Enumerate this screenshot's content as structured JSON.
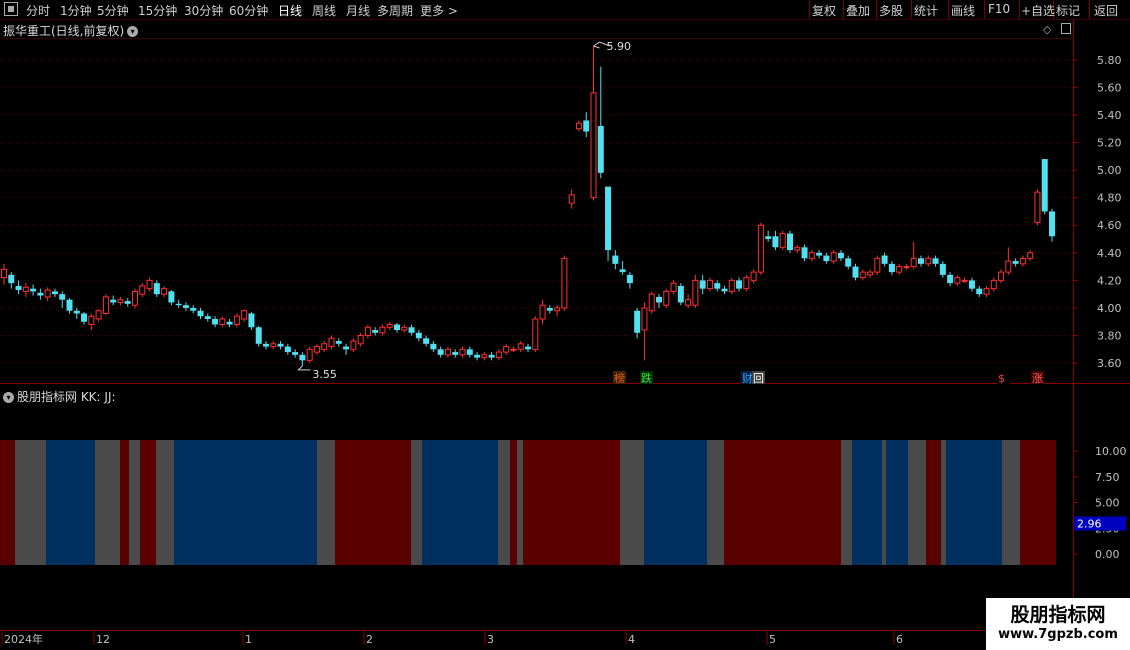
{
  "toolbar": {
    "periods": [
      "分时",
      "1分钟",
      "5分钟",
      "15分钟",
      "30分钟",
      "60分钟",
      "日线",
      "周线",
      "月线",
      "多周期",
      "更多 >"
    ],
    "active_period": "日线",
    "right_buttons": [
      "复权",
      "叠加",
      "多股",
      "统计",
      "画线",
      "F10",
      "+自选",
      "返回"
    ]
  },
  "main_panel": {
    "title": "振华重工(日线,前复权)",
    "high_label": "5.90",
    "low_label": "3.55",
    "price_ticks": [
      "5.80",
      "5.60",
      "5.40",
      "5.20",
      "5.00",
      "4.80",
      "4.60",
      "4.40",
      "4.20",
      "4.00",
      "3.80",
      "3.60"
    ],
    "tags": [
      {
        "text": "榜",
        "color": "#e06020",
        "bg": "#402000"
      },
      {
        "text": "跌",
        "color": "#40e040",
        "bg": "#003000"
      },
      {
        "text": "财",
        "color": "#40a0ff",
        "bg": "#002040"
      },
      {
        "text": "回",
        "color": "#ffffff",
        "bg": "#404040"
      },
      {
        "text": "$",
        "color": "#ff4040",
        "bg": "#000000"
      },
      {
        "text": "涨",
        "color": "#ff6060",
        "bg": "#400000"
      }
    ]
  },
  "indicator_panel": {
    "title": "股朋指标网 KK: JJ:",
    "ticks": [
      "10.00",
      "7.50",
      "5.00",
      "2.50",
      "0.00"
    ],
    "current_value": "2.96",
    "colors": {
      "red": "#5a0000",
      "gray": "#4a4a4a",
      "blue": "#003060"
    },
    "segments": [
      {
        "c": "red",
        "from": 0,
        "to": 15
      },
      {
        "c": "gray",
        "from": 15,
        "to": 46
      },
      {
        "c": "blue",
        "from": 46,
        "to": 95
      },
      {
        "c": "gray",
        "from": 95,
        "to": 120
      },
      {
        "c": "red",
        "from": 120,
        "to": 129
      },
      {
        "c": "gray",
        "from": 129,
        "to": 140
      },
      {
        "c": "red",
        "from": 140,
        "to": 156
      },
      {
        "c": "gray",
        "from": 156,
        "to": 174
      },
      {
        "c": "blue",
        "from": 174,
        "to": 317
      },
      {
        "c": "gray",
        "from": 317,
        "to": 335
      },
      {
        "c": "red",
        "from": 335,
        "to": 411
      },
      {
        "c": "gray",
        "from": 411,
        "to": 422
      },
      {
        "c": "blue",
        "from": 422,
        "to": 498
      },
      {
        "c": "gray",
        "from": 498,
        "to": 510
      },
      {
        "c": "red",
        "from": 510,
        "to": 517
      },
      {
        "c": "gray",
        "from": 517,
        "to": 523
      },
      {
        "c": "red",
        "from": 523,
        "to": 620
      },
      {
        "c": "gray",
        "from": 620,
        "to": 644
      },
      {
        "c": "blue",
        "from": 644,
        "to": 707
      },
      {
        "c": "gray",
        "from": 707,
        "to": 724
      },
      {
        "c": "red",
        "from": 724,
        "to": 841
      },
      {
        "c": "gray",
        "from": 841,
        "to": 852
      },
      {
        "c": "blue",
        "from": 852,
        "to": 882
      },
      {
        "c": "gray",
        "from": 882,
        "to": 886
      },
      {
        "c": "blue",
        "from": 886,
        "to": 908
      },
      {
        "c": "gray",
        "from": 908,
        "to": 926
      },
      {
        "c": "red",
        "from": 926,
        "to": 941
      },
      {
        "c": "gray",
        "from": 941,
        "to": 946
      },
      {
        "c": "blue",
        "from": 946,
        "to": 1002
      },
      {
        "c": "gray",
        "from": 1002,
        "to": 1020
      },
      {
        "c": "red",
        "from": 1020,
        "to": 1056
      }
    ]
  },
  "date_axis": {
    "labels": [
      "2024年",
      "12",
      "1",
      "2",
      "3",
      "4",
      "5",
      "6"
    ]
  },
  "watermark": {
    "line1": "股朋指标网",
    "line2": "www.7gpzb.com"
  },
  "chart_data": {
    "type": "candlestick",
    "title": "振华重工(日线,前复权)",
    "ylim": [
      3.5,
      5.95
    ],
    "colors": {
      "up": "#ff3030",
      "down": "#50e0f0"
    },
    "candles": [
      [
        4.22,
        4.28,
        4.32,
        4.17
      ],
      [
        4.24,
        4.18,
        4.26,
        4.14
      ],
      [
        4.16,
        4.13,
        4.2,
        4.1
      ],
      [
        4.12,
        4.15,
        4.18,
        4.08
      ],
      [
        4.14,
        4.12,
        4.17,
        4.09
      ],
      [
        4.11,
        4.09,
        4.14,
        4.06
      ],
      [
        4.08,
        4.13,
        4.15,
        4.05
      ],
      [
        4.12,
        4.1,
        4.14,
        4.08
      ],
      [
        4.1,
        4.06,
        4.12,
        4.0
      ],
      [
        4.06,
        3.98,
        4.07,
        3.96
      ],
      [
        3.98,
        3.96,
        4.0,
        3.92
      ],
      [
        3.96,
        3.9,
        3.97,
        3.88
      ],
      [
        3.88,
        3.94,
        3.96,
        3.84
      ],
      [
        3.92,
        3.98,
        3.99,
        3.9
      ],
      [
        3.96,
        4.08,
        4.1,
        3.95
      ],
      [
        4.06,
        4.04,
        4.09,
        4.02
      ],
      [
        4.04,
        4.06,
        4.08,
        4.02
      ],
      [
        4.05,
        4.03,
        4.07,
        4.01
      ],
      [
        4.02,
        4.12,
        4.14,
        4.0
      ],
      [
        4.1,
        4.16,
        4.18,
        4.08
      ],
      [
        4.14,
        4.2,
        4.22,
        4.12
      ],
      [
        4.18,
        4.1,
        4.2,
        4.08
      ],
      [
        4.1,
        4.14,
        4.16,
        4.08
      ],
      [
        4.12,
        4.04,
        4.13,
        4.02
      ],
      [
        4.03,
        4.02,
        4.06,
        4.0
      ],
      [
        4.02,
        4.0,
        4.04,
        3.98
      ],
      [
        4.0,
        3.98,
        4.02,
        3.96
      ],
      [
        3.98,
        3.94,
        4.0,
        3.92
      ],
      [
        3.94,
        3.92,
        3.96,
        3.9
      ],
      [
        3.92,
        3.88,
        3.94,
        3.86
      ],
      [
        3.88,
        3.92,
        3.94,
        3.86
      ],
      [
        3.9,
        3.88,
        3.92,
        3.86
      ],
      [
        3.88,
        3.94,
        3.96,
        3.86
      ],
      [
        3.92,
        3.98,
        3.99,
        3.9
      ],
      [
        3.96,
        3.86,
        3.97,
        3.84
      ],
      [
        3.86,
        3.74,
        3.87,
        3.72
      ],
      [
        3.74,
        3.72,
        3.76,
        3.7
      ],
      [
        3.72,
        3.74,
        3.76,
        3.7
      ],
      [
        3.74,
        3.72,
        3.76,
        3.7
      ],
      [
        3.72,
        3.68,
        3.74,
        3.66
      ],
      [
        3.68,
        3.66,
        3.7,
        3.64
      ],
      [
        3.66,
        3.62,
        3.68,
        3.58
      ],
      [
        3.62,
        3.7,
        3.72,
        3.6
      ],
      [
        3.68,
        3.72,
        3.74,
        3.66
      ],
      [
        3.7,
        3.74,
        3.76,
        3.68
      ],
      [
        3.72,
        3.78,
        3.8,
        3.7
      ],
      [
        3.76,
        3.74,
        3.78,
        3.72
      ],
      [
        3.72,
        3.7,
        3.74,
        3.66
      ],
      [
        3.7,
        3.76,
        3.78,
        3.68
      ],
      [
        3.74,
        3.8,
        3.82,
        3.72
      ],
      [
        3.8,
        3.86,
        3.88,
        3.78
      ],
      [
        3.84,
        3.82,
        3.86,
        3.8
      ],
      [
        3.82,
        3.86,
        3.88,
        3.8
      ],
      [
        3.86,
        3.88,
        3.9,
        3.84
      ],
      [
        3.88,
        3.84,
        3.89,
        3.82
      ],
      [
        3.84,
        3.86,
        3.88,
        3.82
      ],
      [
        3.86,
        3.82,
        3.88,
        3.8
      ],
      [
        3.82,
        3.78,
        3.84,
        3.76
      ],
      [
        3.78,
        3.74,
        3.8,
        3.72
      ],
      [
        3.74,
        3.7,
        3.76,
        3.68
      ],
      [
        3.7,
        3.66,
        3.72,
        3.64
      ],
      [
        3.66,
        3.7,
        3.72,
        3.64
      ],
      [
        3.68,
        3.66,
        3.7,
        3.64
      ],
      [
        3.66,
        3.7,
        3.72,
        3.64
      ],
      [
        3.7,
        3.66,
        3.72,
        3.64
      ],
      [
        3.66,
        3.64,
        3.68,
        3.62
      ],
      [
        3.64,
        3.66,
        3.68,
        3.62
      ],
      [
        3.66,
        3.64,
        3.68,
        3.62
      ],
      [
        3.64,
        3.68,
        3.7,
        3.62
      ],
      [
        3.68,
        3.72,
        3.74,
        3.66
      ],
      [
        3.7,
        3.7,
        3.72,
        3.68
      ],
      [
        3.7,
        3.74,
        3.76,
        3.68
      ],
      [
        3.72,
        3.7,
        3.74,
        3.68
      ],
      [
        3.7,
        3.92,
        3.94,
        3.68
      ],
      [
        3.92,
        4.02,
        4.06,
        3.88
      ],
      [
        4.0,
        3.98,
        4.02,
        3.96
      ],
      [
        3.98,
        4.0,
        4.02,
        3.94
      ],
      [
        4.0,
        4.36,
        4.38,
        3.98
      ],
      [
        4.76,
        4.82,
        4.86,
        4.72
      ],
      [
        5.3,
        5.34,
        5.36,
        5.28
      ],
      [
        5.36,
        5.28,
        5.42,
        5.24
      ],
      [
        4.8,
        5.56,
        5.9,
        4.78
      ],
      [
        5.32,
        4.98,
        5.75,
        4.94
      ],
      [
        4.88,
        4.42,
        4.88,
        4.34
      ],
      [
        4.38,
        4.32,
        4.42,
        4.28
      ],
      [
        4.28,
        4.26,
        4.34,
        4.24
      ],
      [
        4.24,
        4.18,
        4.26,
        4.14
      ],
      [
        3.98,
        3.82,
        4.0,
        3.78
      ],
      [
        3.84,
        4.0,
        4.04,
        3.62
      ],
      [
        3.98,
        4.1,
        4.12,
        3.96
      ],
      [
        4.08,
        4.04,
        4.1,
        4.0
      ],
      [
        4.02,
        4.12,
        4.14,
        4.0
      ],
      [
        4.12,
        4.18,
        4.2,
        4.1
      ],
      [
        4.16,
        4.04,
        4.18,
        4.02
      ],
      [
        4.02,
        4.06,
        4.1,
        4.0
      ],
      [
        4.02,
        4.2,
        4.24,
        4.0
      ],
      [
        4.2,
        4.14,
        4.24,
        4.1
      ],
      [
        4.14,
        4.2,
        4.22,
        4.12
      ],
      [
        4.18,
        4.14,
        4.2,
        4.12
      ],
      [
        4.14,
        4.12,
        4.16,
        4.1
      ],
      [
        4.12,
        4.2,
        4.22,
        4.1
      ],
      [
        4.2,
        4.14,
        4.22,
        4.12
      ],
      [
        4.14,
        4.22,
        4.24,
        4.12
      ],
      [
        4.2,
        4.26,
        4.28,
        4.18
      ],
      [
        4.26,
        4.6,
        4.62,
        4.24
      ],
      [
        4.52,
        4.5,
        4.56,
        4.48
      ],
      [
        4.52,
        4.44,
        4.56,
        4.42
      ],
      [
        4.44,
        4.54,
        4.56,
        4.42
      ],
      [
        4.54,
        4.42,
        4.56,
        4.4
      ],
      [
        4.42,
        4.44,
        4.46,
        4.4
      ],
      [
        4.44,
        4.36,
        4.46,
        4.34
      ],
      [
        4.36,
        4.4,
        4.42,
        4.34
      ],
      [
        4.4,
        4.38,
        4.42,
        4.36
      ],
      [
        4.38,
        4.34,
        4.4,
        4.32
      ],
      [
        4.34,
        4.4,
        4.42,
        4.32
      ],
      [
        4.4,
        4.36,
        4.42,
        4.34
      ],
      [
        4.36,
        4.3,
        4.38,
        4.28
      ],
      [
        4.3,
        4.22,
        4.32,
        4.2
      ],
      [
        4.22,
        4.26,
        4.28,
        4.2
      ],
      [
        4.24,
        4.26,
        4.28,
        4.22
      ],
      [
        4.26,
        4.36,
        4.38,
        4.24
      ],
      [
        4.38,
        4.32,
        4.4,
        4.3
      ],
      [
        4.32,
        4.26,
        4.34,
        4.24
      ],
      [
        4.26,
        4.3,
        4.32,
        4.24
      ],
      [
        4.3,
        4.3,
        4.32,
        4.28
      ],
      [
        4.3,
        4.36,
        4.48,
        4.28
      ],
      [
        4.36,
        4.32,
        4.38,
        4.3
      ],
      [
        4.32,
        4.36,
        4.38,
        4.3
      ],
      [
        4.36,
        4.32,
        4.38,
        4.3
      ],
      [
        4.32,
        4.24,
        4.34,
        4.22
      ],
      [
        4.24,
        4.18,
        4.26,
        4.16
      ],
      [
        4.18,
        4.22,
        4.24,
        4.16
      ],
      [
        4.2,
        4.2,
        4.22,
        4.18
      ],
      [
        4.2,
        4.14,
        4.22,
        4.12
      ],
      [
        4.14,
        4.1,
        4.16,
        4.08
      ],
      [
        4.1,
        4.14,
        4.16,
        4.08
      ],
      [
        4.14,
        4.2,
        4.22,
        4.12
      ],
      [
        4.2,
        4.26,
        4.28,
        4.18
      ],
      [
        4.26,
        4.34,
        4.44,
        4.24
      ],
      [
        4.34,
        4.32,
        4.36,
        4.3
      ],
      [
        4.32,
        4.36,
        4.38,
        4.3
      ],
      [
        4.36,
        4.4,
        4.42,
        4.34
      ],
      [
        4.62,
        4.84,
        4.86,
        4.6
      ],
      [
        5.08,
        4.7,
        5.08,
        4.68
      ],
      [
        4.7,
        4.52,
        4.72,
        4.48
      ]
    ]
  }
}
